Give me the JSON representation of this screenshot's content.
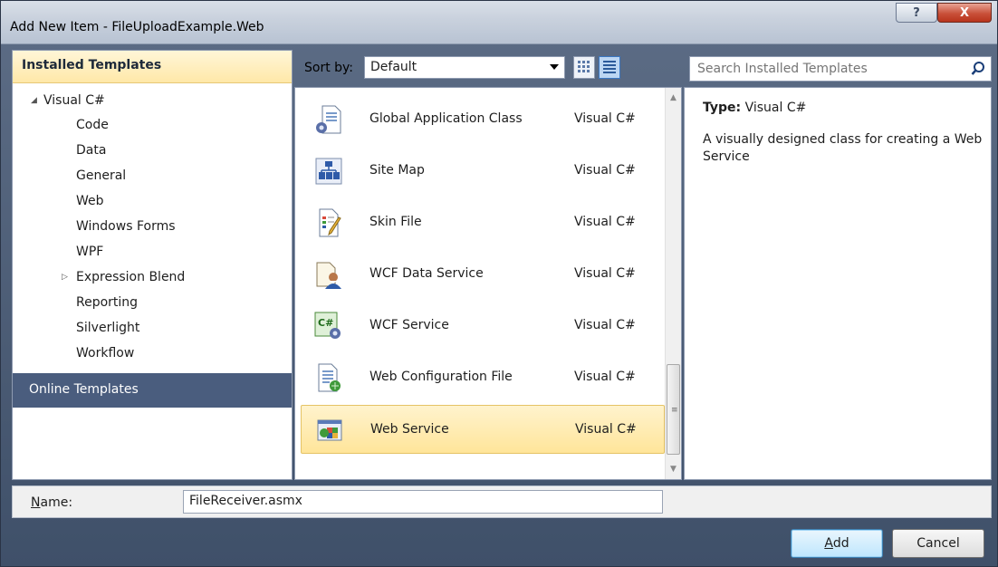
{
  "window": {
    "title": "Add New Item - FileUploadExample.Web",
    "help_glyph": "?",
    "close_glyph": "X"
  },
  "left_panel": {
    "installed_header": "Installed Templates",
    "tree": {
      "root": "Visual C#",
      "items": [
        "Code",
        "Data",
        "General",
        "Web",
        "Windows Forms",
        "WPF",
        "Expression Blend",
        "Reporting",
        "Silverlight",
        "Workflow"
      ]
    },
    "online_header": "Online Templates"
  },
  "toolbar": {
    "sort_label": "Sort by:",
    "sort_value": "Default"
  },
  "search": {
    "placeholder": "Search Installed Templates"
  },
  "templates": [
    {
      "name": "Global Application Class",
      "language": "Visual C#",
      "icon": "global-app-class-icon",
      "selected": false
    },
    {
      "name": "Site Map",
      "language": "Visual C#",
      "icon": "site-map-icon",
      "selected": false
    },
    {
      "name": "Skin File",
      "language": "Visual C#",
      "icon": "skin-file-icon",
      "selected": false
    },
    {
      "name": "WCF Data Service",
      "language": "Visual C#",
      "icon": "wcf-data-service-icon",
      "selected": false
    },
    {
      "name": "WCF Service",
      "language": "Visual C#",
      "icon": "wcf-service-icon",
      "selected": false
    },
    {
      "name": "Web Configuration File",
      "language": "Visual C#",
      "icon": "web-config-file-icon",
      "selected": false
    },
    {
      "name": "Web Service",
      "language": "Visual C#",
      "icon": "web-service-icon",
      "selected": true
    }
  ],
  "details": {
    "type_label": "Type:",
    "type_value": "Visual C#",
    "description": "A visually designed class for creating a Web Service"
  },
  "name_row": {
    "label_accel": "N",
    "label_rest": "ame:",
    "value": "FileReceiver.asmx"
  },
  "buttons": {
    "add_accel": "A",
    "add_rest": "dd",
    "cancel": "Cancel"
  },
  "colors": {
    "selection": "#ffe59a",
    "online_header": "#4a5d7e",
    "installed_header": "#ffe8a8"
  }
}
